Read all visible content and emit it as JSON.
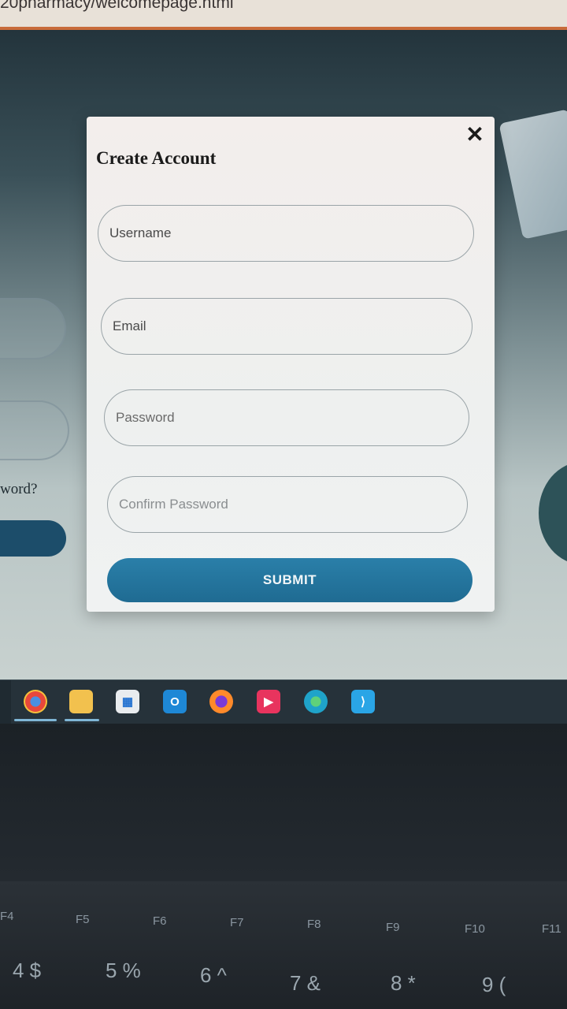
{
  "browser": {
    "url_fragment": "20pharmacy/welcomepage.html"
  },
  "background_page": {
    "forgot_fragment": "word?"
  },
  "modal": {
    "title": "Create Account",
    "close_symbol": "✕",
    "fields": [
      {
        "name": "username",
        "placeholder": "Username",
        "value": ""
      },
      {
        "name": "email",
        "placeholder": "Email",
        "value": ""
      },
      {
        "name": "password",
        "placeholder": "Password",
        "value": ""
      },
      {
        "name": "confirm_password",
        "placeholder": "Confirm Password",
        "value": ""
      }
    ],
    "submit_label": "SUBMIT"
  },
  "taskbar": {
    "icons": [
      {
        "name": "chrome-icon",
        "color": "#e8473b"
      },
      {
        "name": "file-explorer-icon",
        "color": "#f2c14e"
      },
      {
        "name": "microsoft-store-icon",
        "color": "#e9ecef"
      },
      {
        "name": "outlook-icon",
        "color": "#1e88d6"
      },
      {
        "name": "firefox-icon",
        "color": "#ff8a2a"
      },
      {
        "name": "media-player-icon",
        "color": "#e8345e"
      },
      {
        "name": "edge-icon",
        "color": "#1fa3c9"
      },
      {
        "name": "vscode-icon",
        "color": "#2aa5e6"
      }
    ]
  },
  "keyboard": {
    "fn_keys": [
      "F4",
      "F5",
      "F6",
      "F7",
      "F8",
      "F9",
      "F10",
      "F11"
    ],
    "number_keys": [
      "4 $",
      "5 %",
      "6 ^",
      "7 &",
      "8 *",
      "9 ("
    ]
  },
  "colors": {
    "accent": "#2276a0",
    "modal_bg": "#f0f0ef"
  }
}
